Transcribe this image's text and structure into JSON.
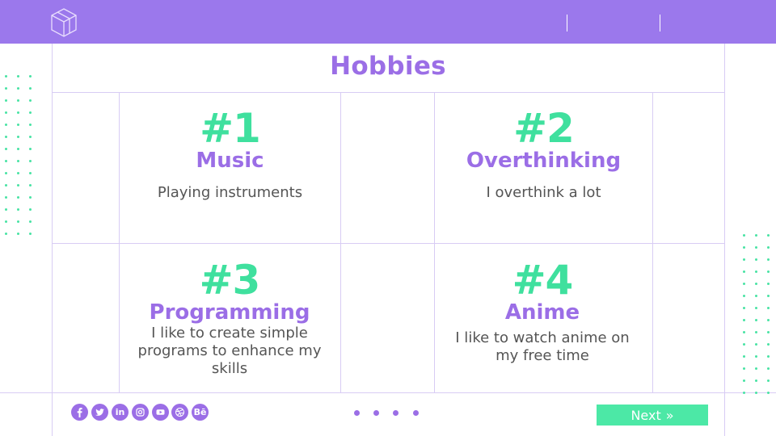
{
  "slide": {
    "title": "Hobbies",
    "hobbies": [
      {
        "number": "#1",
        "name": "Music",
        "description": "Playing instruments"
      },
      {
        "number": "#2",
        "name": "Overthinking",
        "description": "I overthink a lot"
      },
      {
        "number": "#3",
        "name": "Programming",
        "description": "I like to create simple programs to enhance my skills"
      },
      {
        "number": "#4",
        "name": "Anime",
        "description": "I like to watch anime on my free time"
      }
    ]
  },
  "footer": {
    "social_icons": [
      "facebook-icon",
      "twitter-icon",
      "linkedin-icon",
      "instagram-icon",
      "youtube-icon",
      "dribbble-icon",
      "behance-icon"
    ],
    "behance_text": "Bē",
    "linkedin_text": "in",
    "next_label": "Next",
    "next_icon": "»",
    "pager_count": 4
  },
  "colors": {
    "header": "#9b78ec",
    "accent_purple": "#9b6ee6",
    "accent_green": "#3fe09e",
    "button": "#4ce8a6",
    "grid_line": "#d8ccf4"
  }
}
